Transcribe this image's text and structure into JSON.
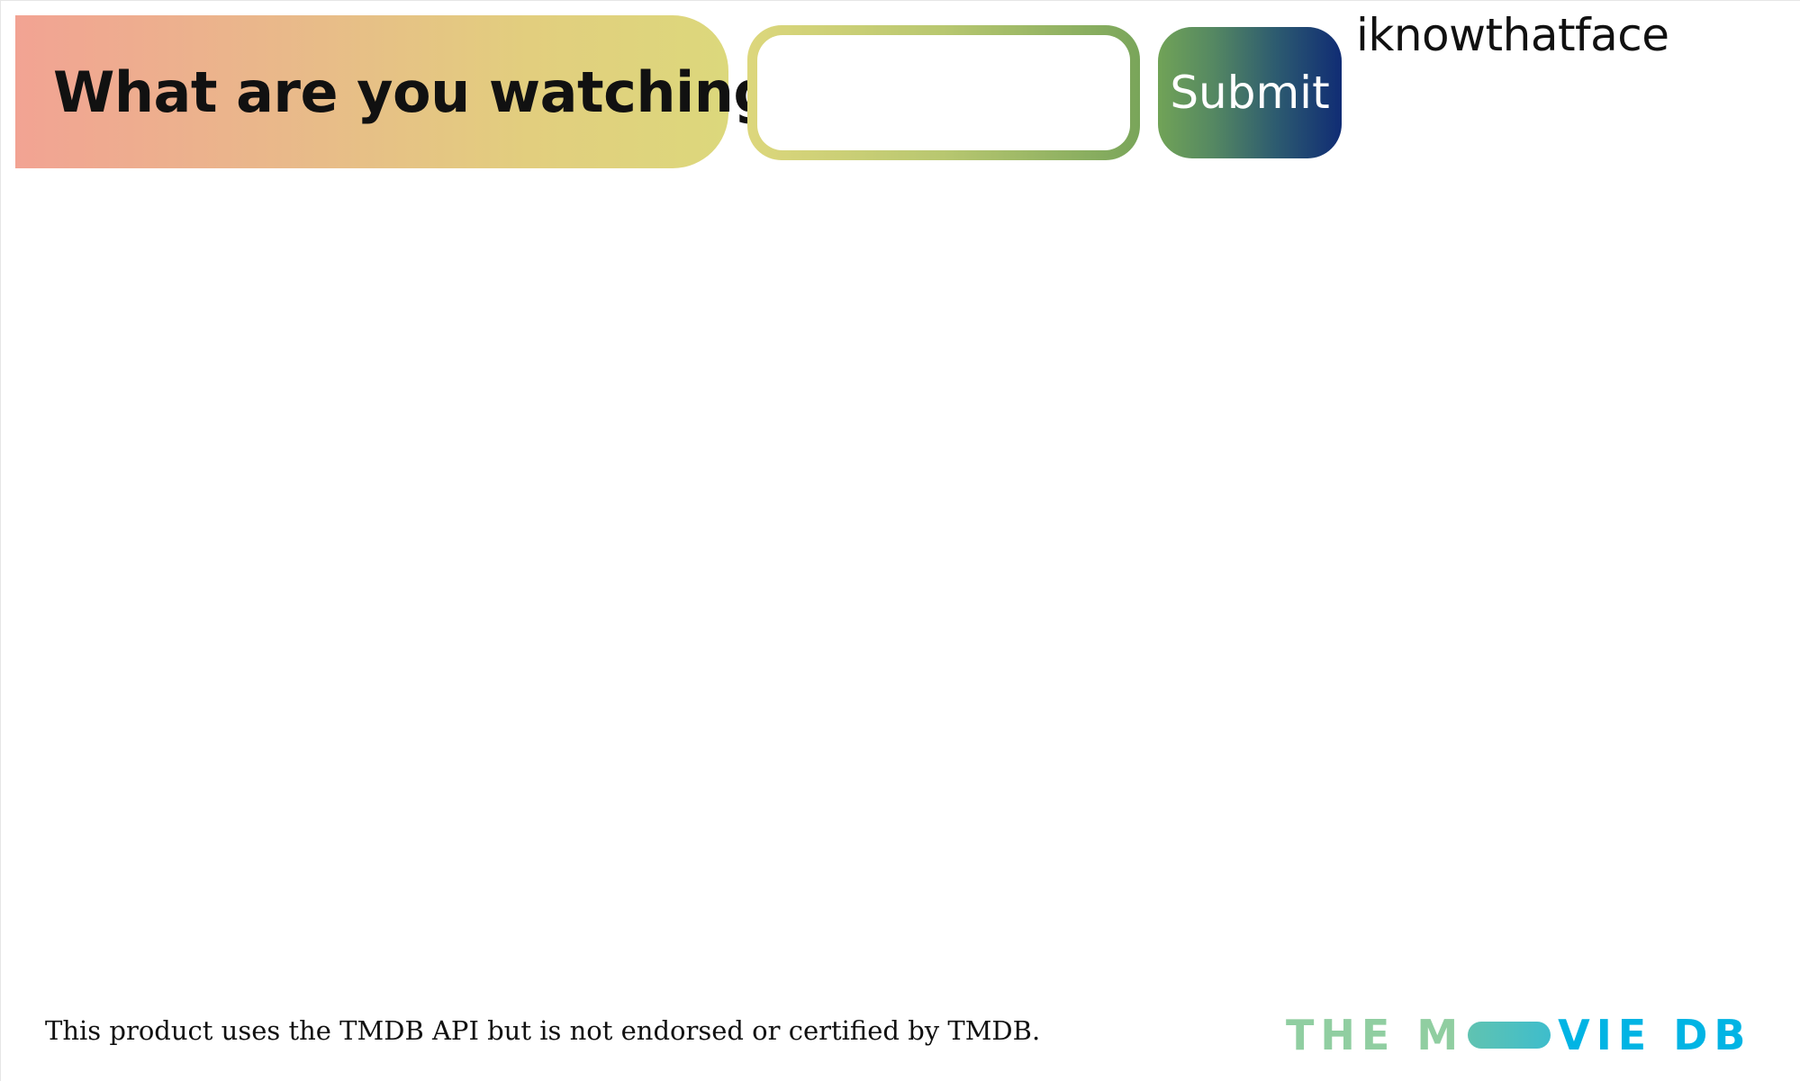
{
  "header": {
    "question": "What are you watching?",
    "search": {
      "value": "",
      "placeholder": ""
    },
    "submit_label": "Submit",
    "brand": "iknowthatface"
  },
  "footer": {
    "disclaimer": "This product uses the TMDB API but is not endorsed or certified by TMDB.",
    "logo": {
      "part1": "THE M",
      "part2": "VIE DB",
      "pill_icon": "pill-icon",
      "colors": {
        "green": "#90cea1",
        "teal": "#3cbec9",
        "blue": "#01b4e4"
      }
    }
  },
  "colors": {
    "banner_start": "#f2a393",
    "banner_end": "#dcd87c",
    "button_start": "#71a357",
    "button_end": "#102c74"
  }
}
